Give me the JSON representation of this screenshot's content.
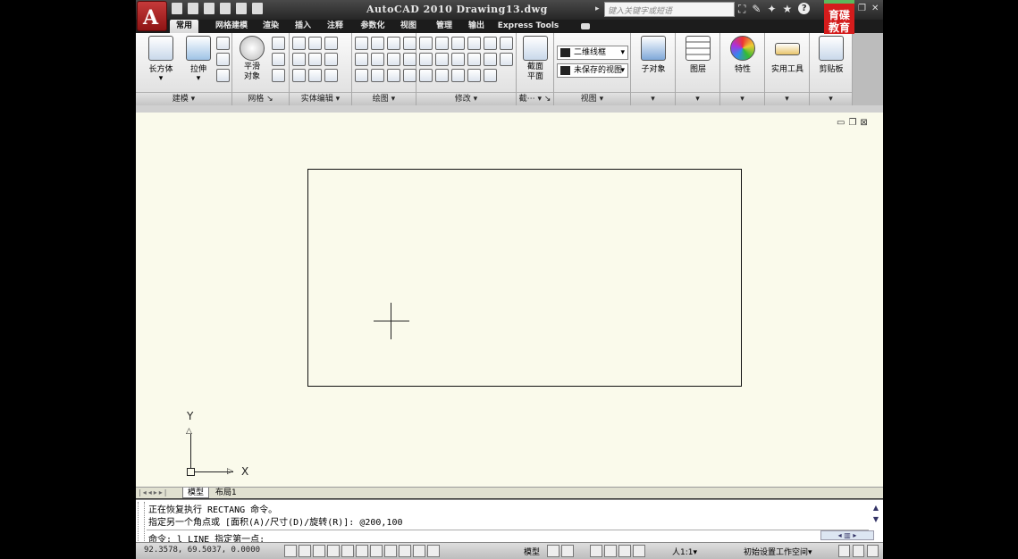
{
  "title_bar": {
    "app_title": "AutoCAD 2010  Drawing13.dwg",
    "search_placeholder": "键入关键字或短语",
    "logo_text": "育碟教育"
  },
  "tabs": [
    "常用",
    "网格建模",
    "渲染",
    "插入",
    "注释",
    "参数化",
    "视图",
    "管理",
    "输出",
    "Express Tools"
  ],
  "ribbon": {
    "modeling": {
      "box_label": "长方体",
      "extrude_label": "拉伸",
      "footer": "建模 ▾"
    },
    "mesh": {
      "smooth_label": "平滑\n对象",
      "footer": "网格",
      "footer_mark": "↘"
    },
    "solid_edit": {
      "footer": "实体编辑 ▾"
    },
    "draw": {
      "footer": "绘图 ▾"
    },
    "modify": {
      "footer": "修改 ▾"
    },
    "section": {
      "plane_label": "截面\n平面",
      "footer": "截⋯ ▾ ↘"
    },
    "view": {
      "visual_style": "二维线框",
      "saved_view": "未保存的视图",
      "footer": "视图 ▾"
    },
    "subobject": {
      "label": "子对象",
      "footer": "▾"
    },
    "layers": {
      "label": "图层",
      "footer": "▾"
    },
    "properties": {
      "label": "特性",
      "footer": "▾"
    },
    "utilities": {
      "label": "实用工具",
      "footer": "▾"
    },
    "clipboard": {
      "label": "剪贴板",
      "footer": "▾"
    }
  },
  "canvas": {
    "ucs_x": "X",
    "ucs_y": "Y"
  },
  "layout_tabs": [
    "模型",
    "布局1"
  ],
  "command": {
    "history": [
      "正在恢复执行 RECTANG 命令。",
      "指定另一个角点或 [面积(A)/尺寸(D)/旋转(R)]: @200,100"
    ],
    "prompt": "命令: l LINE 指定第一点:"
  },
  "status_bar": {
    "coordinates": "92.3578,  69.5037, 0.0000",
    "model_label": "模型",
    "annotation_scale": "人1:1▾",
    "workspace": "初始设置工作空间▾"
  },
  "colors": {
    "canvas_bg": "#fafaeb",
    "app_button": "#b52a2a",
    "logo_bg": "#d41c1c"
  }
}
